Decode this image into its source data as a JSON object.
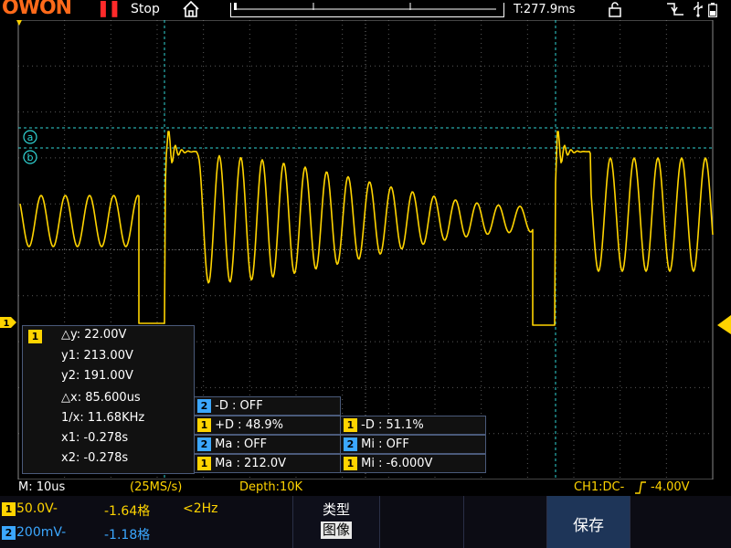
{
  "topbar": {
    "logo": "OWON",
    "run_state": "Stop",
    "trigger_time": "T:277.9ms"
  },
  "cursor_readout": {
    "channel": "1",
    "delta_y": "△y: 22.00V",
    "y1": "y1: 213.00V",
    "y2": "y2: 191.00V",
    "delta_x": "△x: 85.600us",
    "inv_x": "1/x: 11.68KHz",
    "x1": "x1: -0.278s",
    "x2": "x2: -0.278s"
  },
  "measurements": [
    {
      "ch": "2",
      "text": "-D : OFF"
    },
    {
      "ch": "1",
      "text": "+D : 48.9%"
    },
    {
      "ch": "1",
      "text": "-D : 51.1%"
    },
    {
      "ch": "2",
      "text": "Ma : OFF"
    },
    {
      "ch": "2",
      "text": "Mi : OFF"
    },
    {
      "ch": "1",
      "text": "Ma : 212.0V"
    },
    {
      "ch": "1",
      "text": "Mi : -6.000V"
    }
  ],
  "cursor_labels": {
    "a": "a",
    "b": "b"
  },
  "channel_marker": "1",
  "status": {
    "timebase": "M: 10us",
    "sample_rate": "(25MS/s)",
    "depth": "Depth:10K",
    "trigger": "CH1:DC-",
    "trigger_level": "-4.00V"
  },
  "channels": [
    {
      "num": "1",
      "scale": "50.0V-",
      "offset": "-1.64格",
      "freq": "<2Hz"
    },
    {
      "num": "2",
      "scale": "200mV-",
      "offset": "-1.18格",
      "freq": ""
    }
  ],
  "menu": {
    "type_label": "类型",
    "type_value": "图像",
    "save_button": "保存"
  },
  "colors": {
    "ch1": "#ffd400",
    "ch2": "#3ba7ff",
    "cursor": "#2fd3d3",
    "grid": "#5a5a5a",
    "logo": "#ff6a1a"
  }
}
